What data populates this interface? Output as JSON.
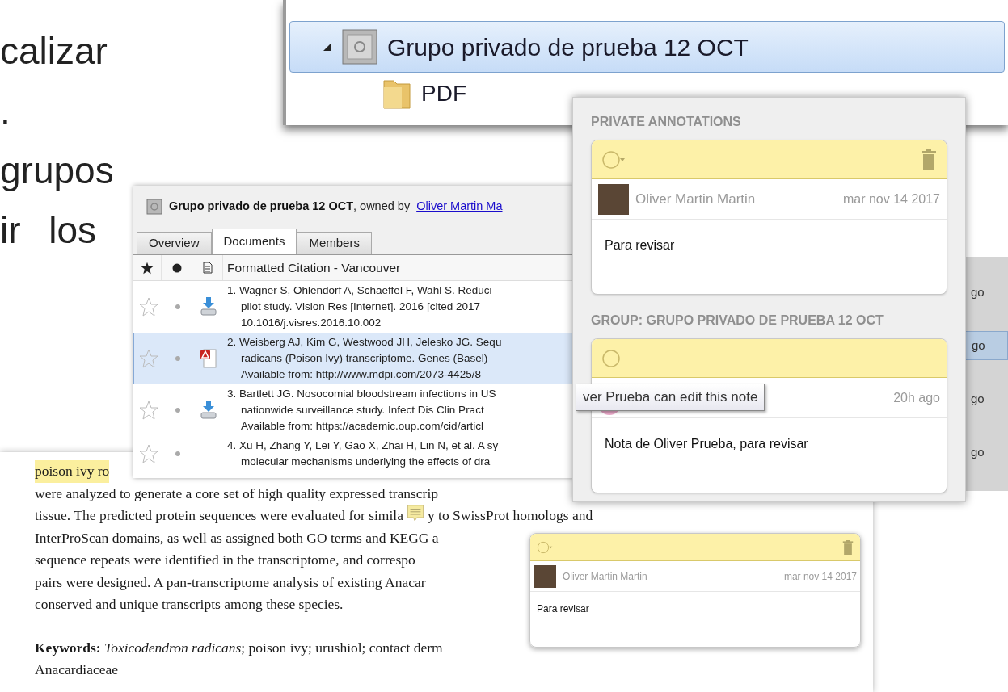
{
  "slide_text": [
    "calizar",
    ".",
    "grupos",
    "ir los"
  ],
  "tree": {
    "items": [
      {
        "label": "Grupo privado de prueba 12 OCT",
        "selected": true,
        "expanded": true,
        "children": [
          {
            "label": "PDF",
            "selected": false
          }
        ]
      }
    ]
  },
  "group_panel": {
    "title": "Grupo privado de prueba 12 OCT",
    "owner_prefix": ", owned by",
    "owner": "Oliver Martin Ma",
    "tabs": [
      {
        "label": "Overview",
        "selected": false
      },
      {
        "label": "Documents",
        "selected": true
      },
      {
        "label": "Members",
        "selected": false
      }
    ],
    "column": "Formatted Citation - Vancouver",
    "rows": [
      {
        "starred": false,
        "kind": "download",
        "selected": false,
        "lines": [
          "1. Wagner S, Ohlendorf A, Schaeffel F, Wahl S. Reduci",
          "pilot study. Vision Res [Internet]. 2016 [cited 2017",
          "10.1016/j.visres.2016.10.002"
        ]
      },
      {
        "starred": false,
        "kind": "pdf",
        "selected": true,
        "lines": [
          "2. Weisberg AJ, Kim G, Westwood JH, Jelesko JG. Sequ",
          "radicans (Poison Ivy) transcriptome. Genes (Basel)",
          "Available from: http://www.mdpi.com/2073-4425/8"
        ]
      },
      {
        "starred": false,
        "kind": "download",
        "selected": false,
        "lines": [
          "3. Bartlett JG. Nosocomial bloodstream infections in US",
          "nationwide surveillance study. Infect Dis Clin Pract",
          "Available from: https://academic.oup.com/cid/articl"
        ]
      },
      {
        "starred": false,
        "kind": "none",
        "selected": false,
        "lines": [
          "4. Xu H, Zhang Y, Lei Y, Gao X, Zhai H, Lin N, et al. A sy",
          "molecular mechanisms underlying the effects of dra"
        ]
      }
    ]
  },
  "annotations": {
    "sections": [
      {
        "heading": "PRIVATE ANNOTATIONS",
        "note": {
          "menu": true,
          "deletable": true,
          "kind": "photo",
          "author": "Oliver Martin Martin",
          "date": "mar nov 14 2017",
          "text": "Para revisar"
        }
      },
      {
        "heading": "GROUP: GRUPO PRIVADO DE PRUEBA 12 OCT",
        "note": {
          "menu": false,
          "deletable": false,
          "kind": "circle",
          "date": "20h ago",
          "text": "Nota de Oliver Prueba, para revisar"
        }
      }
    ],
    "tooltip": "ver Prueba can edit this note"
  },
  "side_fragments": [
    {
      "text": "go",
      "selected": false
    },
    {
      "text": "go",
      "selected": true
    },
    {
      "text": "go",
      "selected": false
    },
    {
      "text": "go",
      "selected": false
    }
  ],
  "document": {
    "lines": [
      {
        "parts": [
          "poison ivy ro"
        ],
        "highlight": true
      },
      {
        "parts": [
          "were analyzed to generate a core set of high quality expressed transcrip"
        ],
        "highlight": false
      },
      {
        "parts": [
          "tissue. The predicted protein sequences were evaluated for simila",
          "y to SwissProt homologs and"
        ],
        "highlight": false
      },
      {
        "parts": [
          "InterProScan domains, as well as assigned both GO terms and KEGG a"
        ],
        "highlight": false
      },
      {
        "parts": [
          "sequence repeats were identified in the transcriptome, and correspo"
        ],
        "highlight": false
      },
      {
        "parts": [
          "pairs were designed. A pan-transcriptome analysis of existing Anacar"
        ],
        "highlight": false
      },
      {
        "parts": [
          "conserved and unique transcripts among these species."
        ],
        "highlight": false
      }
    ],
    "keywords": [
      "**Keywords:** *Toxicodendron radicans*; poison ivy; urushiol; contact derm",
      "Anacardiaceae"
    ]
  },
  "note_popup": {
    "menu": true,
    "deletable": true,
    "author": "Oliver Martin Martin",
    "date": "mar nov 14 2017",
    "text": "Para revisar"
  }
}
